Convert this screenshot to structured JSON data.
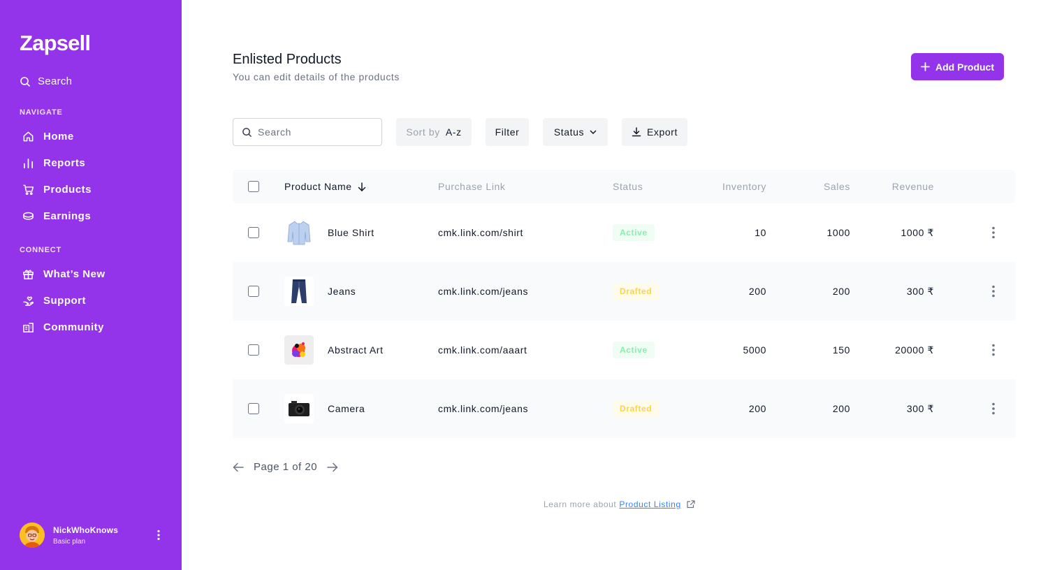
{
  "sidebar": {
    "logo": "Zapsell",
    "search_label": "Search",
    "sections": {
      "navigate": "NAVIGATE",
      "connect": "CONNECT"
    },
    "nav_items": [
      {
        "label": "Home",
        "icon": "home-icon"
      },
      {
        "label": "Reports",
        "icon": "bar-chart-icon"
      },
      {
        "label": "Products",
        "icon": "cart-icon"
      },
      {
        "label": "Earnings",
        "icon": "coins-icon"
      }
    ],
    "connect_items": [
      {
        "label": "What’s New",
        "icon": "gift-icon"
      },
      {
        "label": "Support",
        "icon": "hand-heart-icon"
      },
      {
        "label": "Community",
        "icon": "building-icon"
      }
    ],
    "user": {
      "name": "NickWhoKnows",
      "plan": "Basic plan"
    }
  },
  "header": {
    "title": "Enlisted Products",
    "subtitle": "You can edit details of the products",
    "add_button": "Add Product"
  },
  "toolbar": {
    "search_placeholder": "Search",
    "sort_prefix": "Sort by",
    "sort_value": "A-z",
    "filter": "Filter",
    "status": "Status",
    "export": "Export"
  },
  "table": {
    "columns": [
      "Product Name",
      "Purchase Link",
      "Status",
      "Inventory",
      "Sales",
      "Revenue"
    ],
    "rows": [
      {
        "name": "Blue Shirt",
        "link": "cmk.link.com/shirt",
        "status": "Active",
        "inventory": "10",
        "sales": "1000",
        "revenue": "1000 ₹",
        "thumb": "shirt"
      },
      {
        "name": "Jeans",
        "link": "cmk.link.com/jeans",
        "status": "Drafted",
        "inventory": "200",
        "sales": "200",
        "revenue": "300 ₹",
        "thumb": "jeans"
      },
      {
        "name": "Abstract Art",
        "link": "cmk.link.com/aaart",
        "status": "Active",
        "inventory": "5000",
        "sales": "150",
        "revenue": "20000 ₹",
        "thumb": "art"
      },
      {
        "name": "Camera",
        "link": "cmk.link.com/jeans",
        "status": "Drafted",
        "inventory": "200",
        "sales": "200",
        "revenue": "300 ₹",
        "thumb": "camera"
      }
    ]
  },
  "pagination": {
    "label": "Page 1 of 20"
  },
  "footer": {
    "prefix": "Learn more about",
    "link": "Product Listing"
  },
  "colors": {
    "brand": "#9333ea",
    "active_text": "#86efac",
    "drafted_text": "#fcd34d",
    "link": "#3b82f6"
  }
}
